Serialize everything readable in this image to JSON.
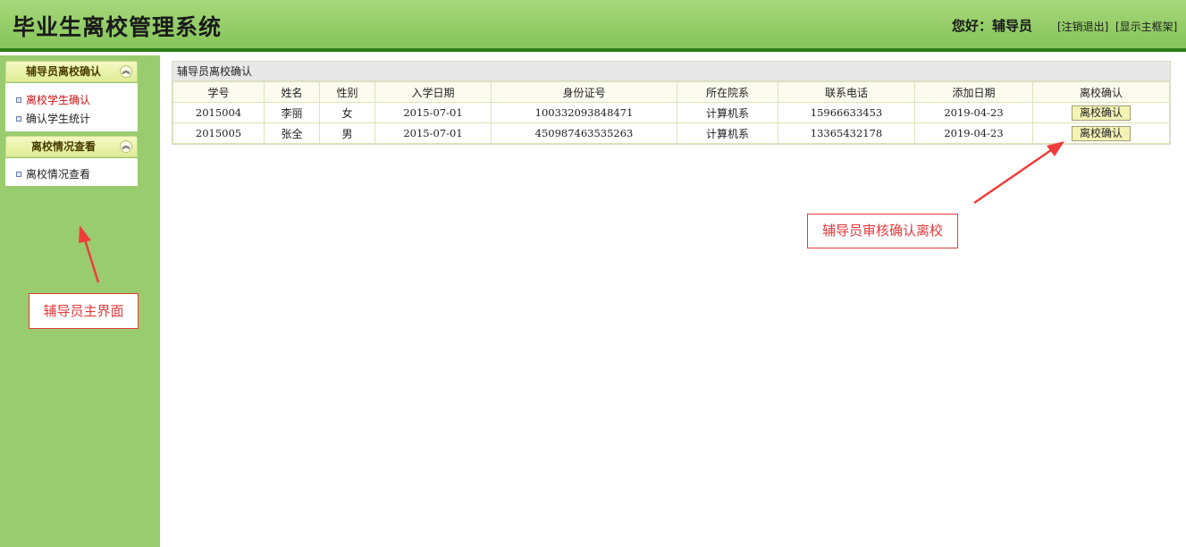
{
  "header": {
    "app_title": "毕业生离校管理系统",
    "greeting": "您好：辅导员",
    "logout_link": "[注销退出]",
    "show_frame_link": "[显示主框架]"
  },
  "sidebar": {
    "groups": [
      {
        "title": "辅导员离校确认",
        "toggle_icon": "double-chevron-up-icon",
        "items": [
          {
            "label": "离校学生确认",
            "active": true
          },
          {
            "label": "确认学生统计",
            "active": false
          }
        ]
      },
      {
        "title": "离校情况查看",
        "toggle_icon": "double-chevron-up-icon",
        "items": [
          {
            "label": "离校情况查看",
            "active": false
          }
        ]
      }
    ]
  },
  "main": {
    "panel_title": "辅导员离校确认",
    "columns": [
      "学号",
      "姓名",
      "性别",
      "入学日期",
      "身份证号",
      "所在院系",
      "联系电话",
      "添加日期",
      "离校确认"
    ],
    "rows": [
      {
        "student_id": "2015004",
        "name": "李丽",
        "gender": "女",
        "enroll_date": "2015-07-01",
        "id_card": "100332093848471",
        "department": "计算机系",
        "phone": "15966633453",
        "added_date": "2019-04-23",
        "action": "离校确认"
      },
      {
        "student_id": "2015005",
        "name": "张全",
        "gender": "男",
        "enroll_date": "2015-07-01",
        "id_card": "450987463535263",
        "department": "计算机系",
        "phone": "13365432178",
        "added_date": "2019-04-23",
        "action": "离校确认"
      }
    ]
  },
  "annotations": {
    "sidebar_note": "辅导员主界面",
    "confirm_note": "辅导员审核确认离校",
    "color": "#e53a3a"
  },
  "colors": {
    "header_green": "#86c55a",
    "header_border": "#2f7d1b",
    "sidebar_green": "#99cc6e",
    "active_menu_text": "#cc1111"
  }
}
